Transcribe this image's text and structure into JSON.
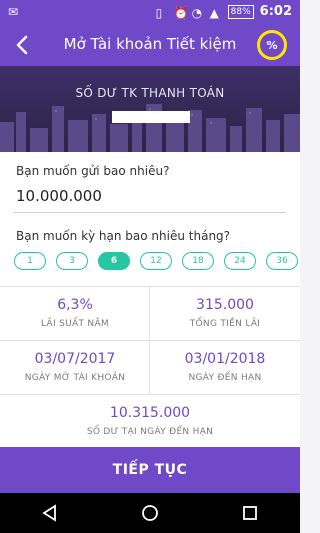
{
  "status": {
    "battery": "88%",
    "time": "6:02"
  },
  "appbar": {
    "title": "Mở Tài khoản Tiết kiệm",
    "percent_label": "%"
  },
  "banner": {
    "label": "SỐ DƯ TK THANH TOÁN"
  },
  "form": {
    "amount_question": "Bạn muốn gửi bao nhiêu?",
    "amount_value": "10.000.000",
    "term_question": "Bạn muốn kỳ hạn bao nhiêu tháng?",
    "terms": [
      "1",
      "3",
      "6",
      "12",
      "18",
      "24",
      "36"
    ],
    "selected_term": "6"
  },
  "summary": {
    "interest_rate_value": "6,3%",
    "interest_rate_label": "LÃI SUẤT NĂM",
    "total_interest_value": "315.000",
    "total_interest_label": "TỔNG TIỀN LÃI",
    "open_date_value": "03/07/2017",
    "open_date_label": "NGÀY MỞ TÀI KHOẢN",
    "maturity_date_value": "03/01/2018",
    "maturity_date_label": "NGÀY ĐẾN HẠN",
    "maturity_balance_value": "10.315.000",
    "maturity_balance_label": "SỐ DƯ TẠI NGÀY ĐẾN HẠN"
  },
  "cta": {
    "label": "TIẾP TỤC"
  },
  "colors": {
    "primary": "#6f49c8",
    "accent": "#26c6a3",
    "highlight": "#ffe600"
  },
  "icons": {
    "back": "back-arrow-icon",
    "percent": "percent-icon",
    "nav_back": "nav-back-icon",
    "nav_home": "nav-home-icon",
    "nav_recent": "nav-recent-apps-icon"
  }
}
